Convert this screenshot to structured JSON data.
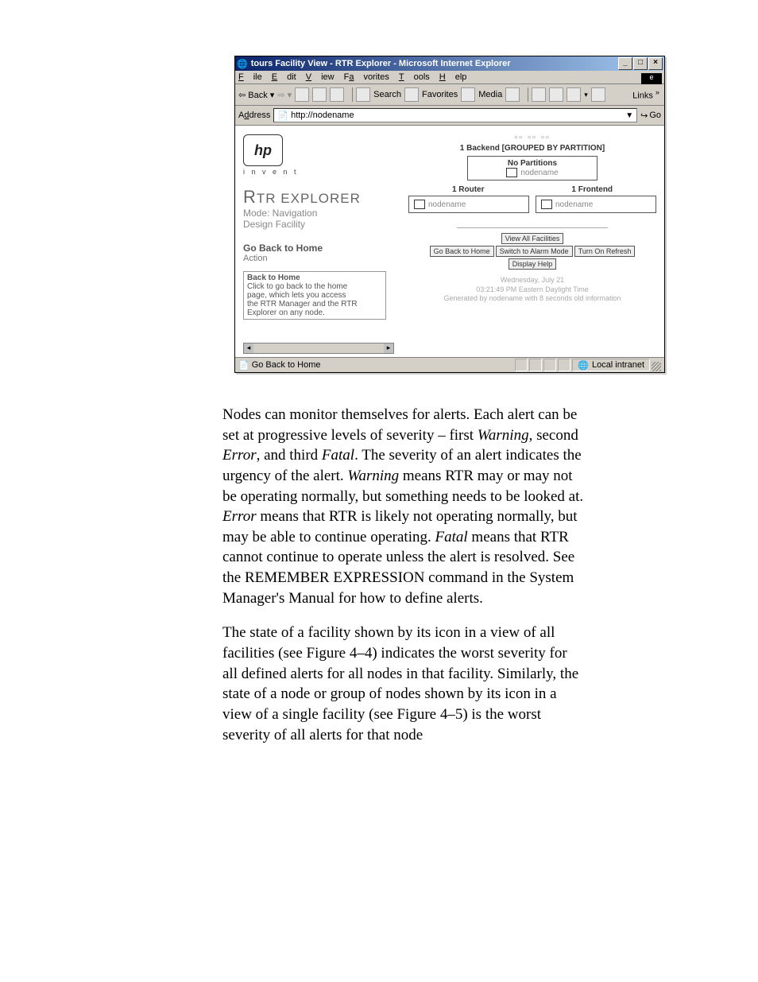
{
  "window": {
    "title": "tours Facility View - RTR Explorer - Microsoft Internet Explorer",
    "controls": {
      "min": "_",
      "max": "□",
      "close": "×"
    }
  },
  "menubar": {
    "file": "File",
    "edit": "Edit",
    "view": "View",
    "favorites": "Favorites",
    "tools": "Tools",
    "help": "Help"
  },
  "toolbar": {
    "back": "Back",
    "search": "Search",
    "favorites": "Favorites",
    "media": "Media",
    "links": "Links"
  },
  "addressbar": {
    "label": "Address",
    "value": "http://nodename",
    "go": "Go"
  },
  "sidebar": {
    "logo_text": "hp",
    "invent": "i n v e n t",
    "app_title_big": "R",
    "app_title_rest": "TR EXPLORER",
    "mode": "Mode:  Navigation",
    "design": "Design Facility",
    "go_back_home": "Go Back to Home",
    "action": "Action",
    "help": {
      "title": "Back to Home",
      "line1": "Click to go back to the home",
      "line2": "page, which lets you access",
      "line3": "the RTR Manager and the RTR",
      "line4": "Explorer on any node."
    }
  },
  "main": {
    "backend_label": "1 Backend [GROUPED BY PARTITION]",
    "no_partitions": "No Partitions",
    "node1": "nodename",
    "router_label": "1 Router",
    "frontend_label": "1 Frontend",
    "node2": "nodename",
    "node3": "nodename",
    "buttons": {
      "view_all": "View All Facilities",
      "go_back": "Go Back to Home",
      "switch_alarm": "Switch to Alarm Mode",
      "turn_on_refresh": "Turn On Refresh",
      "display_help": "Display Help"
    },
    "footer": {
      "l1": "Wednesday, July 21",
      "l2": "03:21:49 PM Eastern Daylight Time",
      "l3": "Generated by nodename with 8 seconds old information"
    }
  },
  "statusbar": {
    "left": "Go Back to Home",
    "zone": "Local intranet"
  },
  "body": {
    "p1a": "Nodes can monitor themselves for alerts. Each alert can be set at progressive levels of severity – first ",
    "p1w": "Warning",
    "p1b": ", second ",
    "p1e": "Error",
    "p1c": ", and third ",
    "p1f": "Fatal",
    "p1d": ". The severity of an alert indicates the urgency of the alert. ",
    "p1w2": "Warning",
    "p1e2text": " means RTR may or may not be operating normally, but something needs to be looked at. ",
    "p1e2": "Error",
    "p1g": " means that RTR is likely not operating normally, but may be able to continue operating. ",
    "p1f2": "Fatal",
    "p1h": " means that RTR cannot continue to operate unless the alert is resolved. See the REMEMBER EXPRESSION command in the System Manager's Manual for how to define alerts.",
    "p2": "The state of a facility shown by its icon in a view of all facilities (see Figure 4–4) indicates the worst severity for all defined alerts for all nodes in that facility. Similarly, the state of a node or group of nodes shown by its icon in a view of a single facility (see Figure 4–5) is the worst severity of all alerts for that node"
  }
}
